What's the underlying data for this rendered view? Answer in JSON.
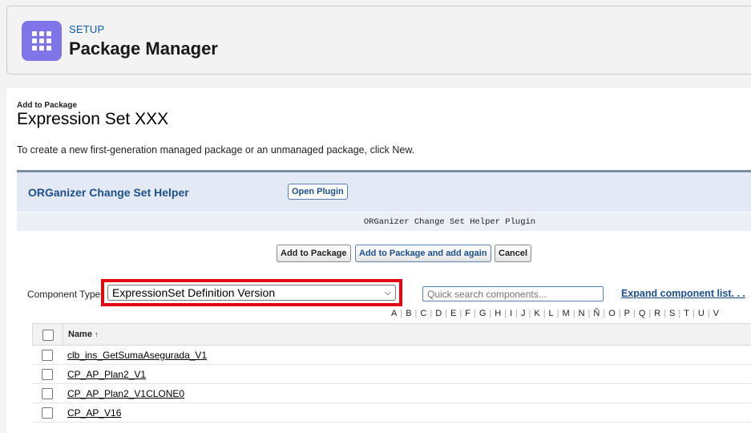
{
  "header": {
    "setup_label": "SETUP",
    "title": "Package Manager",
    "icon": "app-grid-icon",
    "icon_color": "#7f75e8"
  },
  "page": {
    "sub_label": "Add to Package",
    "title": "Expression Set XXX",
    "description": "To create a new first-generation managed package or an unmanaged package, click New."
  },
  "plugin": {
    "title": "ORGanizer Change Set Helper",
    "open_button": "Open Plugin",
    "subtitle": "ORGanizer Change Set Helper Plugin"
  },
  "actions": {
    "add": "Add to Package",
    "add_again": "Add to Package and add again",
    "cancel": "Cancel"
  },
  "filters": {
    "component_type_label": "Component Type",
    "component_type_value": "ExpressionSet Definition Version",
    "search_placeholder": "Quick search components...",
    "expand_link": "Expand component list. . ."
  },
  "alphabet": [
    "A",
    "B",
    "C",
    "D",
    "E",
    "F",
    "G",
    "H",
    "I",
    "J",
    "K",
    "L",
    "M",
    "N",
    "Ñ",
    "O",
    "P",
    "Q",
    "R",
    "S",
    "T",
    "U",
    "V"
  ],
  "table": {
    "header_name": "Name",
    "sort_indicator": "↑",
    "rows": [
      {
        "name": "clb_ins_GetSumaAsegurada_V1"
      },
      {
        "name": "CP_AP_Plan2_V1"
      },
      {
        "name": "CP_AP_Plan2_V1CLONE0"
      },
      {
        "name": "CP_AP_V16"
      }
    ]
  },
  "colors": {
    "accent_link": "#1f4f8a",
    "highlight_border": "#e30613"
  }
}
